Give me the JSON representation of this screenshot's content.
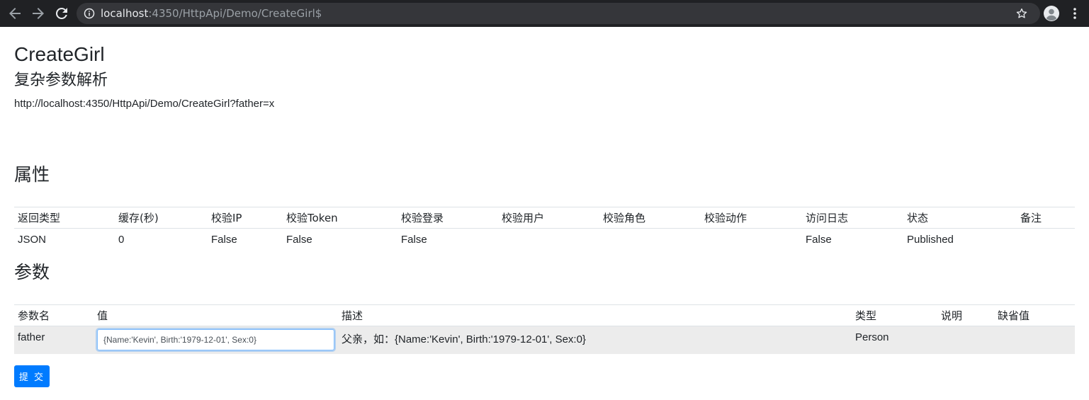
{
  "browser": {
    "url_host": "localhost",
    "url_rest": ":4350/HttpApi/Demo/CreateGirl$"
  },
  "page": {
    "title": "CreateGirl",
    "subtitle": "复杂参数解析",
    "api_url": "http://localhost:4350/HttpApi/Demo/CreateGirl?father=x"
  },
  "attributes": {
    "heading": "属性",
    "headers": [
      "返回类型",
      "缓存(秒)",
      "校验IP",
      "校验Token",
      "校验登录",
      "校验用户",
      "校验角色",
      "校验动作",
      "访问日志",
      "状态",
      "备注"
    ],
    "row": [
      "JSON",
      "0",
      "False",
      "False",
      "False",
      "",
      "",
      "",
      "False",
      "Published",
      ""
    ]
  },
  "parameters": {
    "heading": "参数",
    "headers": [
      "参数名",
      "值",
      "描述",
      "类型",
      "说明",
      "缺省值"
    ],
    "rows": [
      {
        "name": "father",
        "value_placeholder": "{Name:'Kevin', Birth:'1979-12-01', Sex:0}",
        "description": "父亲，如：{Name:'Kevin', Birth:'1979-12-01', Sex:0}",
        "type": "Person",
        "note": "",
        "default": ""
      }
    ]
  },
  "submit_label": "提 交",
  "icons": {
    "back": "arrow-left-icon",
    "forward": "arrow-right-icon",
    "reload": "reload-icon",
    "info": "info-icon",
    "star": "star-icon",
    "avatar": "user-avatar-icon",
    "menu": "kebab-menu-icon"
  },
  "colors": {
    "chrome_bg": "#202124",
    "omnibox_bg": "#35363a",
    "primary": "#007bff",
    "row_bg": "#ececec"
  }
}
